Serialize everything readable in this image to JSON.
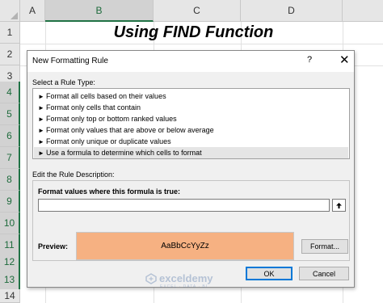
{
  "sheet": {
    "columns": [
      "A",
      "B",
      "C",
      "D"
    ],
    "selected_column": "B",
    "rows": [
      "1",
      "2",
      "3",
      "4",
      "5",
      "6",
      "7",
      "8",
      "9",
      "10",
      "11",
      "12",
      "13",
      "14"
    ],
    "selected_rows": [
      "4",
      "5",
      "6",
      "7",
      "8",
      "9",
      "10",
      "11",
      "12",
      "13"
    ],
    "title_cell": "Using FIND Function"
  },
  "dialog": {
    "title": "New Formatting Rule",
    "help": "?",
    "close": "✕",
    "select_rule_type_label": "Select a Rule Type:",
    "rule_types": [
      "Format all cells based on their values",
      "Format only cells that contain",
      "Format only top or bottom ranked values",
      "Format only values that are above or below average",
      "Format only unique or duplicate values",
      "Use a formula to determine which cells to format"
    ],
    "selected_rule_index": 5,
    "edit_description_label": "Edit the Rule Description:",
    "formula_label": "Format values where this formula is true:",
    "formula_value": "",
    "collapse_icon": "range-select-icon",
    "preview_label": "Preview:",
    "preview_text": "AaBbCcYyZz",
    "preview_color": "#f6b182",
    "format_button": "Format...",
    "ok_button": "OK",
    "cancel_button": "Cancel"
  },
  "watermark": {
    "name": "exceldemy",
    "tagline": "EXCEL · DATA · BI"
  }
}
